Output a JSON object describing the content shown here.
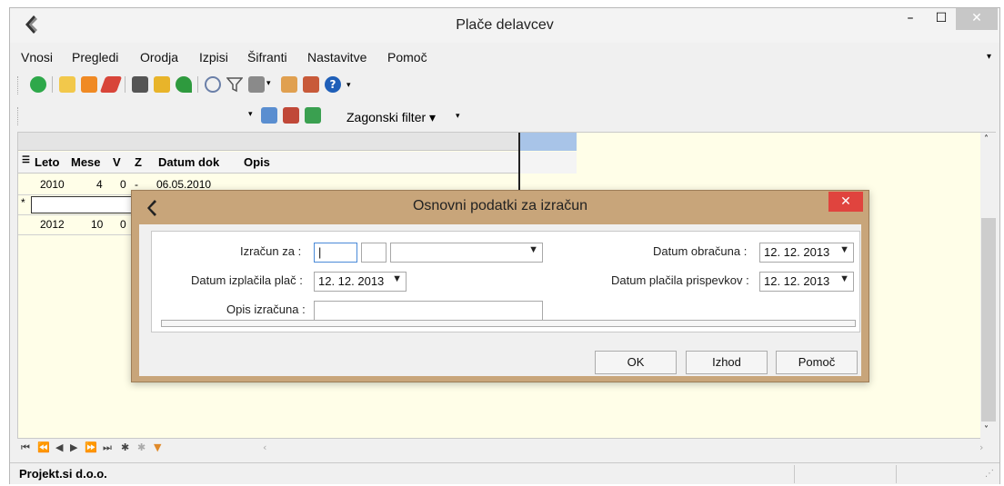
{
  "window": {
    "title": "Plače delavcev"
  },
  "menu": [
    {
      "label": "Vnosi"
    },
    {
      "label": "Pregledi"
    },
    {
      "label": "Orodja"
    },
    {
      "label": "Izpisi"
    },
    {
      "label": "Šifranti"
    },
    {
      "label": "Nastavitve"
    },
    {
      "label": "Pomoč"
    }
  ],
  "toolbar2": {
    "filter_label": "Zagonski filter ▾"
  },
  "grid": {
    "columns": [
      "Leto",
      "Mese",
      "V",
      "Z",
      "Datum dok",
      "Opis"
    ],
    "rows": [
      {
        "leto": "2010",
        "mesec": "4",
        "v": "0",
        "z": "-",
        "datum": "06.05.2010",
        "opis": ""
      },
      {
        "leto": "",
        "mesec": "",
        "v": "",
        "z": "",
        "datum": "",
        "opis": "",
        "new": "*"
      },
      {
        "leto": "2012",
        "mesec": "10",
        "v": "0",
        "z": "",
        "datum": "",
        "opis": ""
      }
    ]
  },
  "status": {
    "company": "Projekt.si d.o.o."
  },
  "dialog": {
    "title": "Osnovni podatki za izračun",
    "izracun_za_label": "Izračun za :",
    "datum_izplacila_label": "Datum izplačila plač :",
    "datum_izplacila_value": "12. 12. 2013",
    "opis_label": "Opis izračuna :",
    "opis_value": "",
    "datum_obracuna_label": "Datum obračuna :",
    "datum_obracuna_value": "12. 12. 2013",
    "datum_placila_label": "Datum plačila prispevkov :",
    "datum_placila_value": "12. 12. 2013",
    "ok_label": "OK",
    "izhod_label": "Izhod",
    "pomoc_label": "Pomoč"
  }
}
